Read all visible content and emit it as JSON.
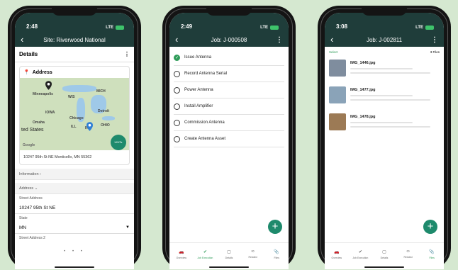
{
  "phone1": {
    "time": "2:48",
    "network": "LTE",
    "title": "Site: Riverwood National",
    "details_heading": "Details",
    "address_card_title": "Address",
    "map_labels": [
      "Minneapolis",
      "WIS",
      "MICH",
      "IOWA",
      "Chicago",
      "Detroit",
      "Omaha",
      "ILL",
      "IND",
      "OHIO",
      "ted States",
      "Google"
    ],
    "unit_button": "UNITs",
    "address_line": "10247 95th St NE Monticello, MN 55362",
    "information_section": "Information",
    "address_section": "Address",
    "fields": [
      {
        "label": "Street Address",
        "value": "10247 95th St NE"
      },
      {
        "label": "State",
        "value": "MN"
      },
      {
        "label": "Street Address 2",
        "value": ""
      }
    ],
    "page_dots": "• • •"
  },
  "phone2": {
    "time": "2:49",
    "network": "LTE",
    "title": "Job: J-000508",
    "tasks": [
      {
        "label": "Issue Antenna",
        "done": true
      },
      {
        "label": "Record Antenna Serial",
        "done": false
      },
      {
        "label": "Power Antenna",
        "done": false
      },
      {
        "label": "Install Amplifier",
        "done": false
      },
      {
        "label": "Commission Antenna",
        "done": false
      },
      {
        "label": "Create Antenna Asset",
        "done": false
      }
    ],
    "fab": "+",
    "tabs": [
      "Overview",
      "Job Execution",
      "Details",
      "Related",
      "Files"
    ],
    "active_tab": "Job Execution"
  },
  "phone3": {
    "time": "3:08",
    "network": "LTE",
    "title": "Job: J-002811",
    "select_label": "Select",
    "files_count": "3 Files",
    "files": [
      {
        "name": "IMG_1446.jpg",
        "thumb_color": "#7f8d9e"
      },
      {
        "name": "IMG_1477.jpg",
        "thumb_color": "#8aa3b8"
      },
      {
        "name": "IMG_1478.jpg",
        "thumb_color": "#9c7a55"
      }
    ],
    "fab": "+",
    "tabs": [
      "Overview",
      "Job Execution",
      "Details",
      "Related",
      "Files"
    ],
    "active_tab": "Files"
  },
  "colors": {
    "header": "#1f3d3a",
    "accent": "#2f9c59",
    "fab": "#1e8a6c",
    "background": "#d5e8d0"
  }
}
